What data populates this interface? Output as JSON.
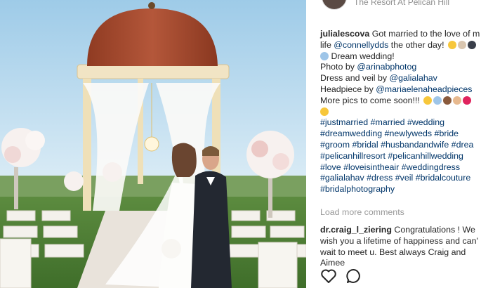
{
  "post": {
    "location": "The Resort At Pelican Hill"
  },
  "caption": {
    "username": "julialescova",
    "line1_text": " Got married to the love of m",
    "line2_mention": "@connellydds",
    "line2_prefix": "life ",
    "line2_suffix": " the other day!",
    "line3_text": " Dream wedding!",
    "line4_prefix": "Photo by ",
    "line4_mention": "@arinabphotog",
    "line5_prefix": "Dress and veil by ",
    "line5_mention": "@galialahav",
    "line6_prefix": "Headpiece by ",
    "line6_mention": "@mariaelenaheadpieces",
    "line7_text": "More pics to come soon!!!",
    "hashtags": [
      "#justmarried #married #wedding",
      "#dreamwedding #newlyweds #bride",
      "#groom #bridal #husbandandwife #drea",
      "#pelicanhillresort #pelicanhillwedding",
      "#love #loveisintheair #weddingdress",
      "#galialahav #dress #veil #bridalcouture",
      "#bridalphotography"
    ]
  },
  "load_more": "Load more comments",
  "comment": {
    "username": "dr.craig_l_ziering",
    "line1_text": " Congratulations ! We",
    "line2": "wish you a lifetime of happiness and can'",
    "line3": "wait to meet u. Best always Craig and",
    "line4": "Aimee"
  },
  "icons": {
    "like": "heart-icon",
    "comment": "comment-icon"
  },
  "colors": {
    "link": "#003569",
    "muted": "#999999",
    "text": "#262626"
  }
}
